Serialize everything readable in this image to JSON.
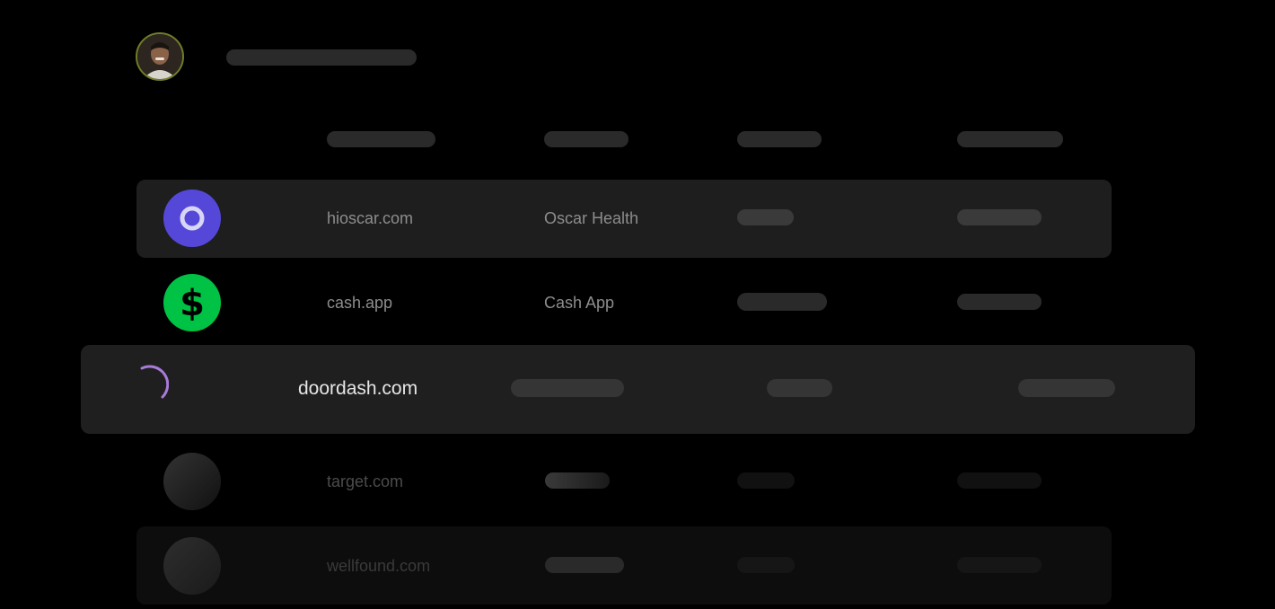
{
  "rows": [
    {
      "domain": "hioscar.com",
      "company": "Oscar Health",
      "logo": "oscar-logo-icon",
      "logo_color": "#5548d9"
    },
    {
      "domain": "cash.app",
      "company": "Cash App",
      "logo": "cash-app-logo-icon",
      "logo_color": "#00c244"
    },
    {
      "domain": "doordash.com",
      "company": "",
      "logo": "loading-spinner-icon",
      "accent": "#a77bd9"
    },
    {
      "domain": "target.com",
      "company": "",
      "logo": "placeholder-logo-icon"
    },
    {
      "domain": "wellfound.com",
      "company": "",
      "logo": "placeholder-logo-icon"
    }
  ],
  "colors": {
    "background": "#000000",
    "row_highlight": "#1f1f1f",
    "skeleton": "#2a2a2a"
  }
}
